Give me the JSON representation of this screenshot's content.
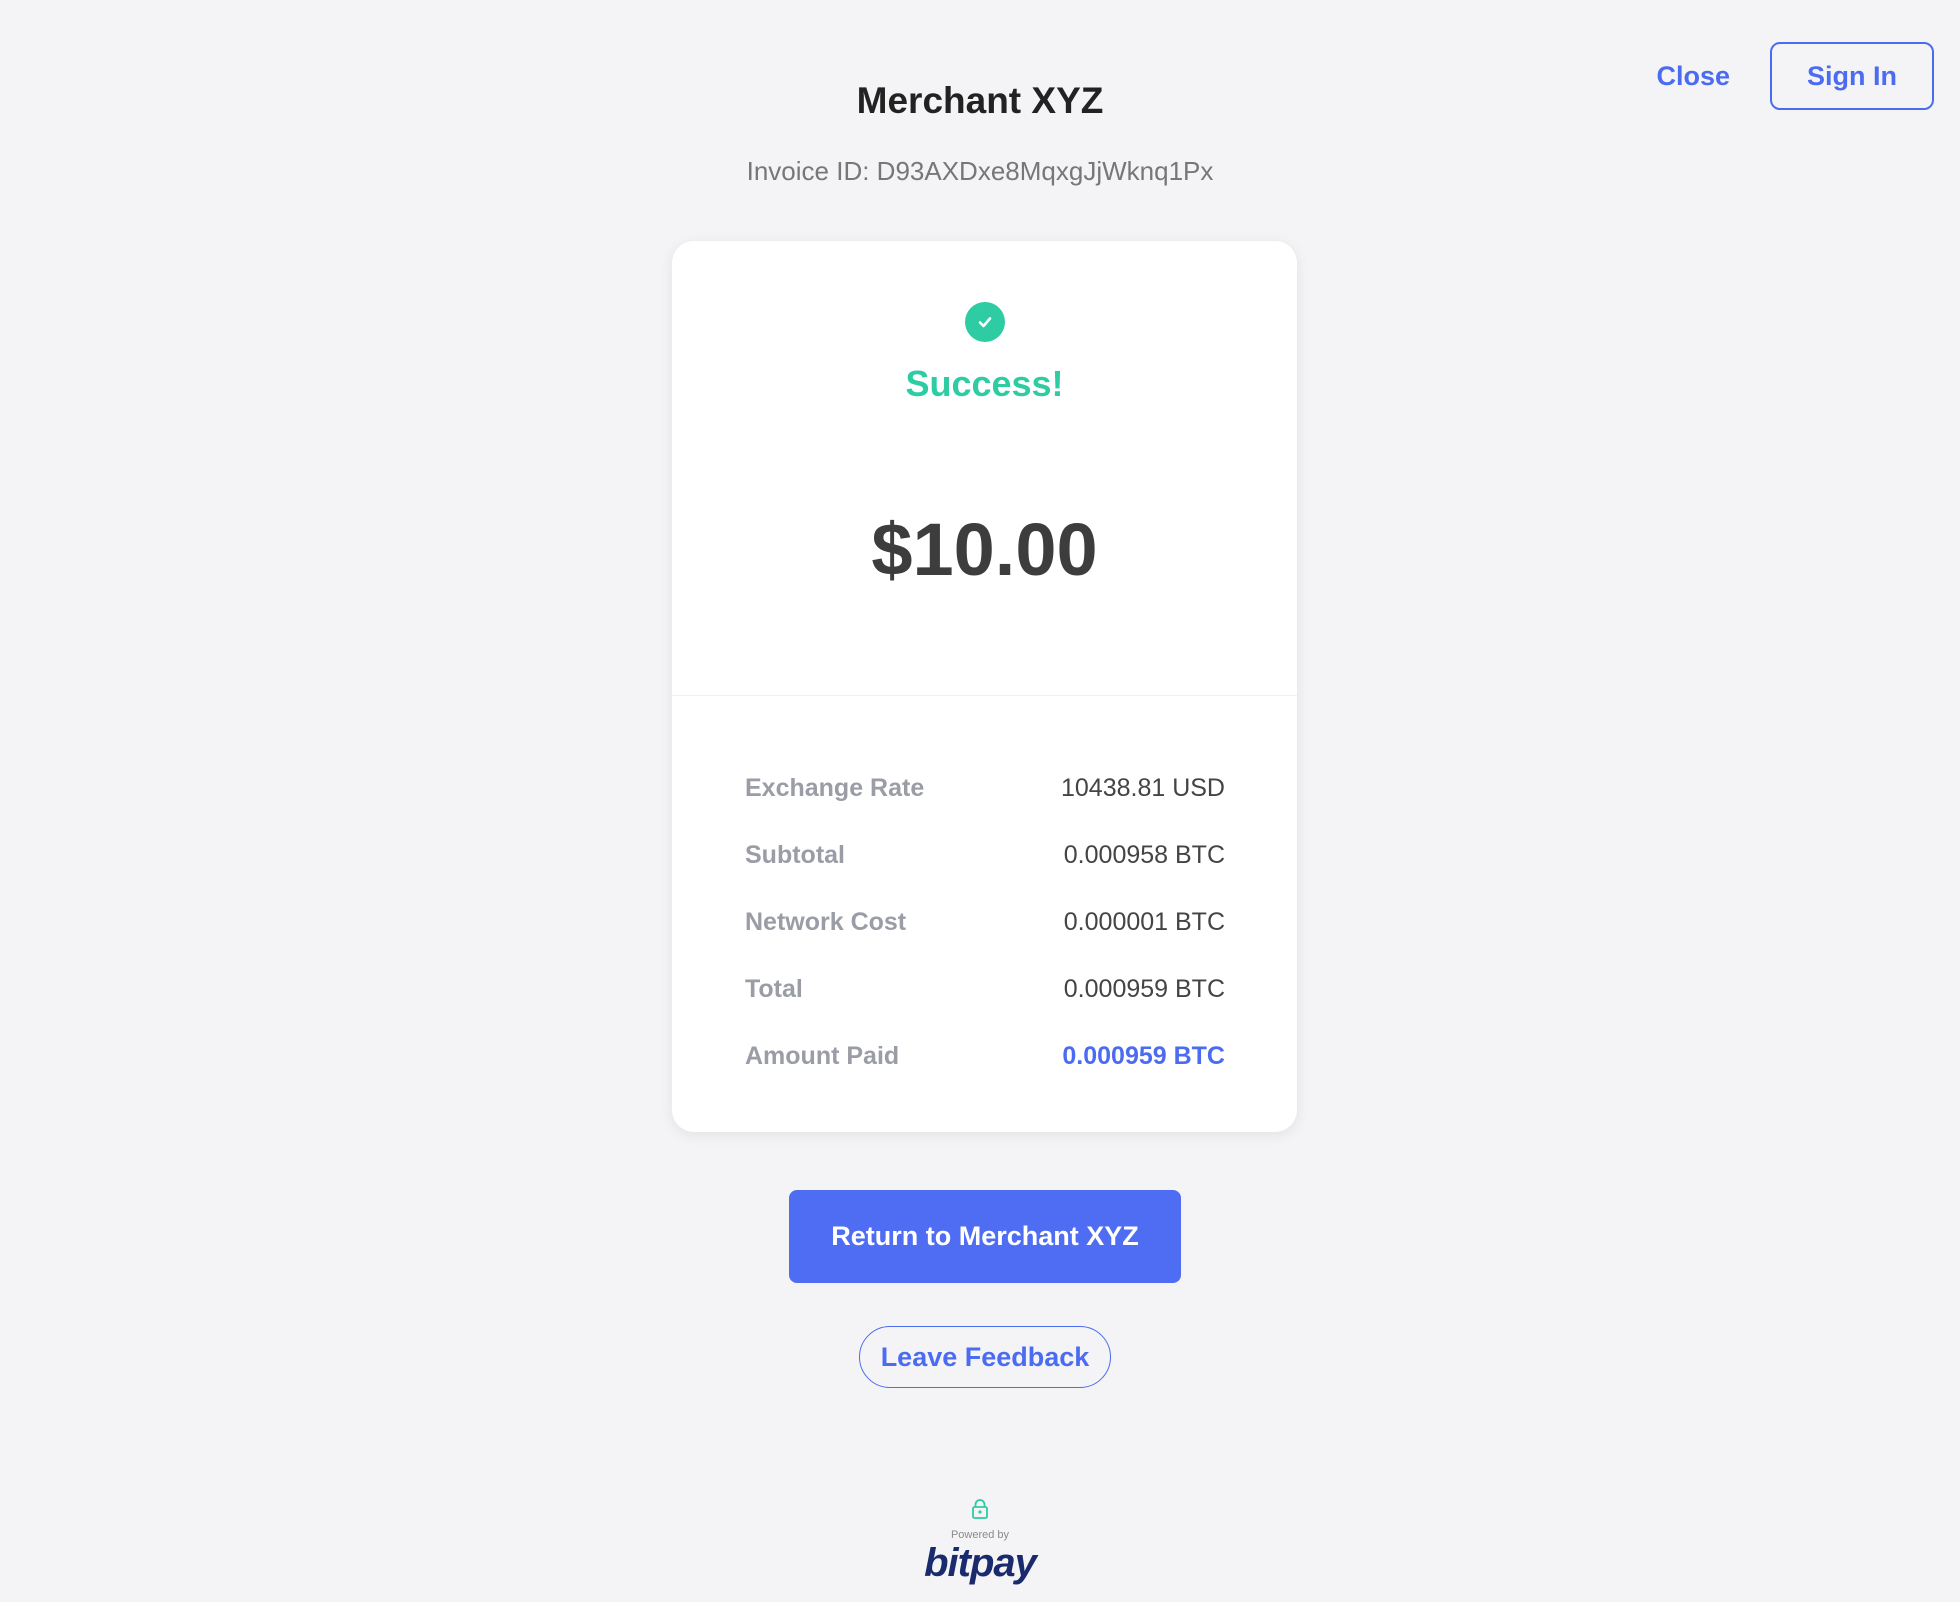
{
  "header": {
    "merchant_name": "Merchant XYZ",
    "invoice_label": "Invoice ID: D93AXDxe8MqxgJjWknq1Px"
  },
  "top_actions": {
    "close_label": "Close",
    "sign_in_label": "Sign In"
  },
  "card": {
    "status_text": "Success!",
    "amount": "$10.00",
    "details": [
      {
        "label": "Exchange Rate",
        "value": "10438.81 USD"
      },
      {
        "label": "Subtotal",
        "value": "0.000958 BTC"
      },
      {
        "label": "Network Cost",
        "value": "0.000001 BTC"
      },
      {
        "label": "Total",
        "value": "0.000959 BTC"
      },
      {
        "label": "Amount Paid",
        "value": "0.000959 BTC"
      }
    ]
  },
  "actions": {
    "return_label": "Return to Merchant XYZ",
    "feedback_label": "Leave Feedback"
  },
  "footer": {
    "powered_by": "Powered by",
    "brand": "bitpay"
  },
  "colors": {
    "accent": "#4b6cf1",
    "success": "#2dcca2",
    "background": "#f4f4f6",
    "brand_logo": "#1a2b6d"
  },
  "icons": {
    "status": "check-circle-icon",
    "footer": "lock-icon"
  }
}
